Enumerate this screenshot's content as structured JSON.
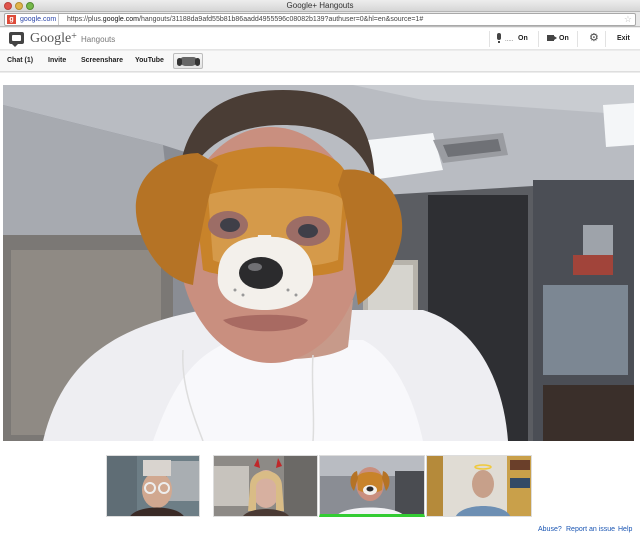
{
  "browser": {
    "window_title": "Google+ Hangouts",
    "site_label": "google.com",
    "url_prefix": "https://plus.",
    "url_domain": "google.com",
    "url_rest": "/hangouts/31188da9afd55b81b86aadd4955596c08082b139?authuser=0&hl=en&source=1#"
  },
  "header": {
    "logo_text": "Google",
    "logo_plus": "+",
    "app_name": "Hangouts",
    "mic_status": "On",
    "mic_level": ".....",
    "cam_status": "On",
    "exit_label": "Exit"
  },
  "toolbar": {
    "chat_label": "Chat (1)",
    "invite_label": "Invite",
    "screenshare_label": "Screenshare",
    "youtube_label": "YouTube"
  },
  "filmstrip": {
    "participants": [
      {
        "effect": "glasses-and-hat"
      },
      {
        "effect": "devil-horns"
      },
      {
        "effect": "dog-mask"
      },
      {
        "effect": "halo"
      }
    ],
    "active_index": 2
  },
  "footer": {
    "abuse_label": "Abuse?",
    "report_label": "Report an issue",
    "help_label": "Help"
  },
  "colors": {
    "accent_link": "#1a55b3",
    "active_green": "#33cc33",
    "dog_mask": "#c8832a"
  }
}
